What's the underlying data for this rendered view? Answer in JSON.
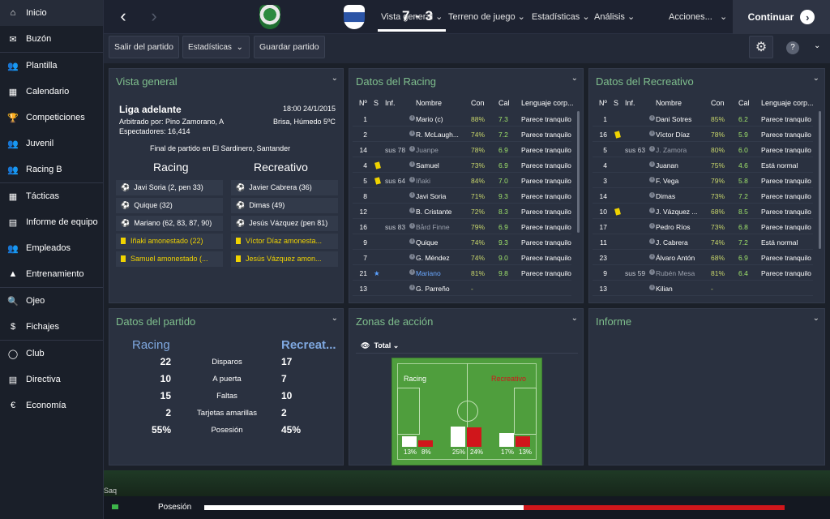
{
  "sidebar": {
    "items": [
      "Inicio",
      "Buzón",
      "Plantilla",
      "Calendario",
      "Competiciones",
      "Juvenil",
      "Racing B",
      "Tácticas",
      "Informe de equipo",
      "Empleados",
      "Entrenamiento",
      "Ojeo",
      "Fichajes",
      "Club",
      "Directiva",
      "Economía"
    ]
  },
  "header": {
    "score": "7 - 3",
    "tabs": [
      "Vista general",
      "Terreno de juego",
      "Estadísticas",
      "Análisis",
      "Acciones..."
    ],
    "continue": "Continuar"
  },
  "toolbar": {
    "exit": "Salir del partido",
    "stats": "Estadísticas",
    "save": "Guardar partido"
  },
  "overview": {
    "title": "Vista general",
    "league": "Liga adelante",
    "datetime": "18:00 24/1/2015",
    "referee": "Arbitrado por: Pino Zamorano, A",
    "weather": "Brisa, Húmedo 5ºC",
    "spectators": "Espectadores: 16,414",
    "venue": "Final de partido en El Sardinero, Santander",
    "home": "Racing",
    "away": "Recreativo",
    "home_events": [
      {
        "type": "goal",
        "text": "Javi Soria (2, pen 33)"
      },
      {
        "type": "goal",
        "text": "Quique (32)"
      },
      {
        "type": "goal",
        "text": "Mariano (62, 83, 87, 90)"
      },
      {
        "type": "card",
        "text": "Iñaki amonestado (22)"
      },
      {
        "type": "card",
        "text": "Samuel amonestado (..."
      }
    ],
    "away_events": [
      {
        "type": "goal",
        "text": "Javier Cabrera (36)"
      },
      {
        "type": "goal",
        "text": "Dimas (49)"
      },
      {
        "type": "goal",
        "text": "Jesús Vázquez (pen 81)"
      },
      {
        "type": "card",
        "text": "Víctor Díaz amonesta..."
      },
      {
        "type": "card",
        "text": "Jesús Vázquez amon..."
      }
    ]
  },
  "racing": {
    "title": "Datos del Racing",
    "headers": [
      "Nº",
      "S",
      "Inf.",
      "Nombre",
      "Con",
      "Cal",
      "Lenguaje corp..."
    ],
    "rows": [
      [
        "1",
        "",
        "",
        "Mario (c)",
        "88%",
        "7.3",
        "Parece tranquilo"
      ],
      [
        "2",
        "",
        "",
        "R. McLaugh...",
        "74%",
        "7.2",
        "Parece tranquilo"
      ],
      [
        "14",
        "",
        "sus 78",
        "Juanpe",
        "78%",
        "6.9",
        "Parece tranquilo"
      ],
      [
        "4",
        "y",
        "",
        "Samuel",
        "73%",
        "6.9",
        "Parece tranquilo"
      ],
      [
        "5",
        "y",
        "sus 64",
        "Iñaki",
        "84%",
        "7.0",
        "Parece tranquilo"
      ],
      [
        "8",
        "",
        "",
        "Javi Soria",
        "71%",
        "9.3",
        "Parece tranquilo"
      ],
      [
        "12",
        "",
        "",
        "B. Cristante",
        "72%",
        "8.3",
        "Parece tranquilo"
      ],
      [
        "16",
        "",
        "sus 83",
        "Bård Finne",
        "79%",
        "6.9",
        "Parece tranquilo"
      ],
      [
        "9",
        "",
        "",
        "Quique",
        "74%",
        "9.3",
        "Parece tranquilo"
      ],
      [
        "7",
        "",
        "",
        "G. Méndez",
        "74%",
        "9.0",
        "Parece tranquilo"
      ],
      [
        "21",
        "★",
        "",
        "Mariano",
        "81%",
        "9.8",
        "Parece tranquilo"
      ],
      [
        "13",
        "",
        "",
        "G. Parreño",
        "-",
        "",
        ""
      ]
    ]
  },
  "recre": {
    "title": "Datos del Recreativo",
    "headers": [
      "Nº",
      "S",
      "Inf.",
      "Nombre",
      "Con",
      "Cal",
      "Lenguaje corp..."
    ],
    "rows": [
      [
        "1",
        "",
        "",
        "Dani Sotres",
        "85%",
        "6.2",
        "Parece tranquilo"
      ],
      [
        "16",
        "y",
        "",
        "Víctor Díaz",
        "78%",
        "5.9",
        "Parece tranquilo"
      ],
      [
        "5",
        "",
        "sus 63",
        "J. Zamora",
        "80%",
        "6.0",
        "Parece tranquilo"
      ],
      [
        "4",
        "",
        "",
        "Juanan",
        "75%",
        "4.6",
        "Está normal"
      ],
      [
        "3",
        "",
        "",
        "F. Vega",
        "79%",
        "5.8",
        "Parece tranquilo"
      ],
      [
        "14",
        "",
        "",
        "Dimas",
        "73%",
        "7.2",
        "Parece tranquilo"
      ],
      [
        "10",
        "y",
        "",
        "J. Vázquez ...",
        "68%",
        "8.5",
        "Parece tranquilo"
      ],
      [
        "17",
        "",
        "",
        "Pedro Ríos",
        "73%",
        "6.8",
        "Parece tranquilo"
      ],
      [
        "11",
        "",
        "",
        "J. Cabrera",
        "74%",
        "7.2",
        "Está normal"
      ],
      [
        "23",
        "",
        "",
        "Álvaro Antón",
        "68%",
        "6.9",
        "Parece tranquilo"
      ],
      [
        "9",
        "",
        "sus 59",
        "Rubén Mesa",
        "81%",
        "6.4",
        "Parece tranquilo"
      ],
      [
        "13",
        "",
        "",
        "Kilian",
        "-",
        "",
        ""
      ]
    ]
  },
  "matchstats": {
    "title": "Datos del partido",
    "home": "Racing",
    "away": "Recreat...",
    "rows": [
      [
        "22",
        "Disparos",
        "17"
      ],
      [
        "10",
        "A puerta",
        "7"
      ],
      [
        "15",
        "Faltas",
        "10"
      ],
      [
        "2",
        "Tarjetas amarillas",
        "2"
      ],
      [
        "55%",
        "Posesión",
        "45%"
      ]
    ]
  },
  "zones": {
    "title": "Zonas de acción",
    "filter": "Total",
    "home": "Racing",
    "away": "Recreativo",
    "bars": [
      {
        "home": 13,
        "away": 8
      },
      {
        "home": 25,
        "away": 24
      },
      {
        "home": 17,
        "away": 13
      }
    ],
    "labels": [
      [
        "13%",
        "8%"
      ],
      [
        "25%",
        "24%"
      ],
      [
        "17%",
        "13%"
      ]
    ]
  },
  "report": {
    "title": "Informe"
  },
  "footer": {
    "label": "Posesión",
    "home_possession": 55,
    "ticker": "Saq"
  },
  "colors": {
    "accent": "#7fbf8d",
    "home": "#ffffff",
    "away": "#d0161b"
  }
}
